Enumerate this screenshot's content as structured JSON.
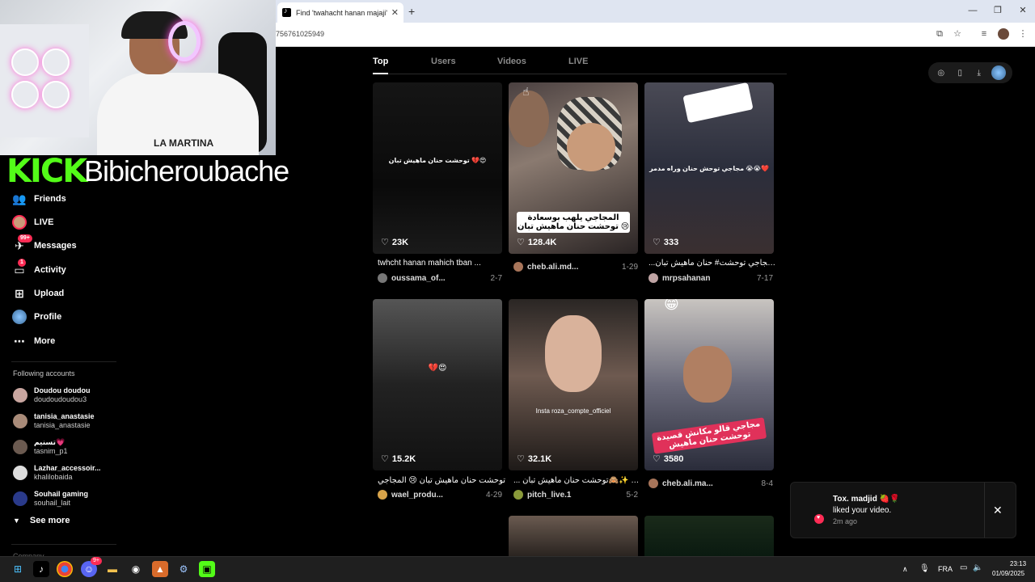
{
  "browser": {
    "tab_title": "Find 'twahacht hanan majaji' on",
    "tab_close": "✕",
    "new_tab": "+",
    "url_fragment": "756761025949",
    "win_min": "—",
    "win_max": "❐",
    "win_close": "✕"
  },
  "stream": {
    "platform_logo": "KICK",
    "streamer_name": "Bibicheroubache",
    "shirt_text": "LA MARTINA"
  },
  "nav": {
    "items": [
      {
        "label": "Friends",
        "icon": "friends-icon"
      },
      {
        "label": "LIVE",
        "icon": "live-icon"
      },
      {
        "label": "Messages",
        "icon": "messages-icon",
        "badge": "99+"
      },
      {
        "label": "Activity",
        "icon": "activity-icon",
        "badge": "1"
      },
      {
        "label": "Upload",
        "icon": "upload-icon"
      },
      {
        "label": "Profile",
        "icon": "profile-icon"
      },
      {
        "label": "More",
        "icon": "more-icon"
      }
    ],
    "following_title": "Following accounts",
    "accounts": [
      {
        "name": "Doudou doudou",
        "handle": "doudoudoudou3",
        "color": "#c9a6a0"
      },
      {
        "name": "tanisia_anastasie",
        "handle": "tanisia_anastasie",
        "color": "#a98b79"
      },
      {
        "name": "تسنيم💗",
        "handle": "tasnim_p1",
        "color": "#6b5a50"
      },
      {
        "name": "Lazhar_accessoir...",
        "handle": "khalilobaida",
        "color": "#ddd"
      },
      {
        "name": "Souhail gaming",
        "handle": "souhail_lait",
        "color": "#2a3a8a"
      }
    ],
    "see_more": "See more",
    "company_cut": "Company"
  },
  "search_tabs": [
    "Top",
    "Users",
    "Videos",
    "LIVE"
  ],
  "videos": [
    {
      "likes": "23K",
      "caption": "twhcht hanan mahich tban ...",
      "user": "oussama_of...",
      "date": "2-7",
      "overlay": "توحشت حنان ماهيش تبان 💔😍",
      "bg": "linear-gradient(180deg,#151515,#0a0a0a 60%,#1a1a1a)",
      "av": "#777"
    },
    {
      "likes": "128.4K",
      "caption": "",
      "user": "cheb.ali.md...",
      "date": "1-29",
      "banner": "المجاجي يلهب بوسعادة توحشت حنان ماهيش تبان 😢",
      "bg": "linear-gradient(160deg,#4a4040,#8a7a70 40%,#2a2424)",
      "av": "#a8755a"
    },
    {
      "likes": "333",
      "caption": "...اي المجاجي توحشت# حنان ماهيش تبان",
      "user": "mrpsahanan",
      "date": "7-17",
      "overlay": "مجاجي توحش حنان وراه مدمر 😭😭❤️",
      "bg": "linear-gradient(180deg,#4a4a55,#2b2e3c 50%,#3a2f30)",
      "av": "#bfa4a4"
    },
    {
      "likes": "15.2K",
      "caption": "توحشت حنان ماهيش تبان 😢 المجاجي",
      "user": "wael_produ...",
      "date": "4-29",
      "overlay": "💔😍",
      "bg": "linear-gradient(180deg,#555,#222 50%,#111)",
      "av": "#d8a44a"
    },
    {
      "likes": "32.1K",
      "caption": "... روزة# ✨🙈توحشت حنان ماهيش تبان",
      "user": "pitch_live.1",
      "date": "5-2",
      "overlay": "Insta roza_compte_officiel",
      "bg": "linear-gradient(180deg,#2a2624,#6e5a50 45%,#1e1a18)",
      "av": "#8a9a3a"
    },
    {
      "likes": "3580",
      "caption": "",
      "user": "cheb.ali.ma...",
      "date": "8-4",
      "banner": "مجاجي قالو مكانش قصيدة توحشت حنان ماهيش",
      "bg": "linear-gradient(180deg,#c8c4c0,#6a6a7a 50%,#2a2c3a)",
      "av": "#a8755a"
    }
  ],
  "notification": {
    "who": "Tox. madjid 🍓🌹",
    "what": "liked your video.",
    "when": "2m ago",
    "close": "✕"
  },
  "taskbar": {
    "lang": "FRA",
    "time": "23:13",
    "date": "01/09/2025",
    "discord_badge": "9+"
  },
  "colors": {
    "accent": "#fe2c55",
    "kick_green": "#53fc18"
  }
}
